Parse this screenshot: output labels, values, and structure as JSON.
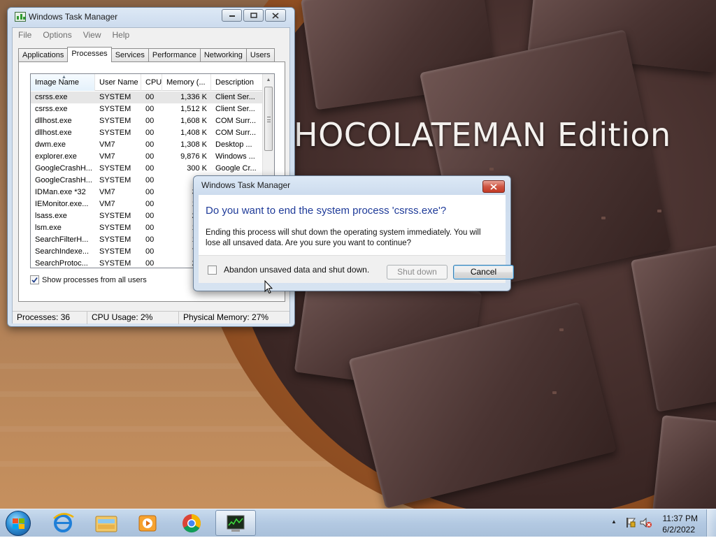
{
  "wallpaper": {
    "caption": "HOCOLATEMAN Edition"
  },
  "task_manager": {
    "title": "Windows Task Manager",
    "menu": [
      "File",
      "Options",
      "View",
      "Help"
    ],
    "tabs": [
      "Applications",
      "Processes",
      "Services",
      "Performance",
      "Networking",
      "Users"
    ],
    "active_tab": "Processes",
    "columns": [
      "Image Name",
      "User Name",
      "CPU",
      "Memory (...",
      "Description"
    ],
    "processes": [
      {
        "name": "csrss.exe",
        "user": "SYSTEM",
        "cpu": "00",
        "mem": "1,336 K",
        "desc": "Client Ser..."
      },
      {
        "name": "csrss.exe",
        "user": "SYSTEM",
        "cpu": "00",
        "mem": "1,512 K",
        "desc": "Client Ser..."
      },
      {
        "name": "dllhost.exe",
        "user": "SYSTEM",
        "cpu": "00",
        "mem": "1,608 K",
        "desc": "COM Surr..."
      },
      {
        "name": "dllhost.exe",
        "user": "SYSTEM",
        "cpu": "00",
        "mem": "1,408 K",
        "desc": "COM Surr..."
      },
      {
        "name": "dwm.exe",
        "user": "VM7",
        "cpu": "00",
        "mem": "1,308 K",
        "desc": "Desktop ..."
      },
      {
        "name": "explorer.exe",
        "user": "VM7",
        "cpu": "00",
        "mem": "9,876 K",
        "desc": "Windows ..."
      },
      {
        "name": "GoogleCrashH...",
        "user": "SYSTEM",
        "cpu": "00",
        "mem": "300 K",
        "desc": "Google Cr..."
      },
      {
        "name": "GoogleCrashH...",
        "user": "SYSTEM",
        "cpu": "00",
        "mem": "24",
        "desc": ""
      },
      {
        "name": "IDMan.exe *32",
        "user": "VM7",
        "cpu": "00",
        "mem": "3,88",
        "desc": ""
      },
      {
        "name": "IEMonitor.exe...",
        "user": "VM7",
        "cpu": "00",
        "mem": "1,07",
        "desc": ""
      },
      {
        "name": "lsass.exe",
        "user": "SYSTEM",
        "cpu": "00",
        "mem": "2,49",
        "desc": ""
      },
      {
        "name": "lsm.exe",
        "user": "SYSTEM",
        "cpu": "00",
        "mem": "1,33",
        "desc": ""
      },
      {
        "name": "SearchFilterH...",
        "user": "SYSTEM",
        "cpu": "00",
        "mem": "1,78",
        "desc": ""
      },
      {
        "name": "SearchIndexe...",
        "user": "SYSTEM",
        "cpu": "00",
        "mem": "7,72",
        "desc": ""
      },
      {
        "name": "SearchProtoc...",
        "user": "SYSTEM",
        "cpu": "00",
        "mem": "2,34",
        "desc": ""
      }
    ],
    "show_all_label": "Show processes from all users",
    "show_all_checked": true,
    "status": {
      "processes": "Processes: 36",
      "cpu": "CPU Usage: 2%",
      "memory": "Physical Memory: 27%"
    }
  },
  "dialog": {
    "title": "Windows Task Manager",
    "main_instruction": "Do you want to end the system process 'csrss.exe'?",
    "content_line1": "Ending this process will shut down the operating system immediately.  You will",
    "content_line2": "lose all unsaved data.  Are you sure you want to continue?",
    "checkbox_label": "Abandon unsaved data and shut down.",
    "checkbox_checked": false,
    "shutdown_label": "Shut down",
    "cancel_label": "Cancel"
  },
  "taskbar": {
    "pinned": [
      "internet-explorer-icon",
      "windows-explorer-icon",
      "media-player-icon",
      "chrome-icon",
      "task-manager-icon"
    ],
    "time": "11:37 PM",
    "date": "6/2/2022"
  }
}
